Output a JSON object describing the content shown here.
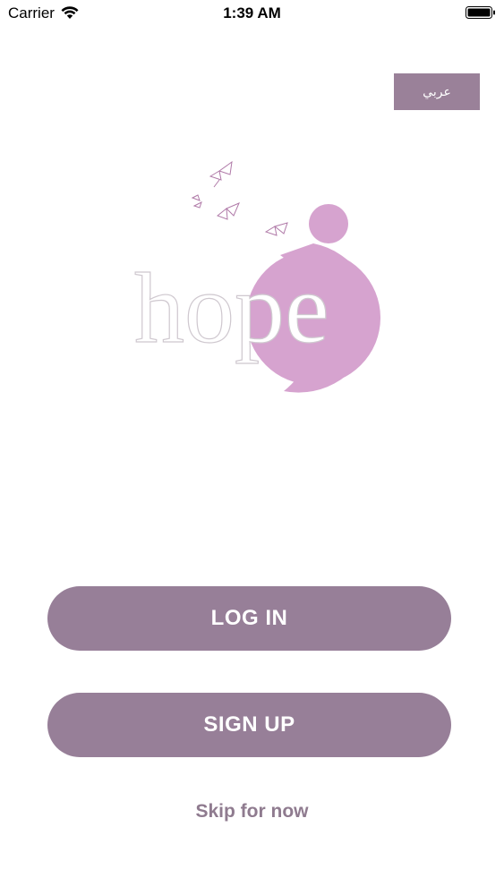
{
  "status_bar": {
    "carrier": "Carrier",
    "time": "1:39 AM"
  },
  "language_button": {
    "label": "عربي"
  },
  "logo": {
    "text": "hope"
  },
  "actions": {
    "login_label": "LOG IN",
    "signup_label": "SIGN UP",
    "skip_label": "Skip for now"
  },
  "colors": {
    "button": "#977f98",
    "logo_pink": "#d6a3cf",
    "skip_text": "#8f7b8f"
  }
}
